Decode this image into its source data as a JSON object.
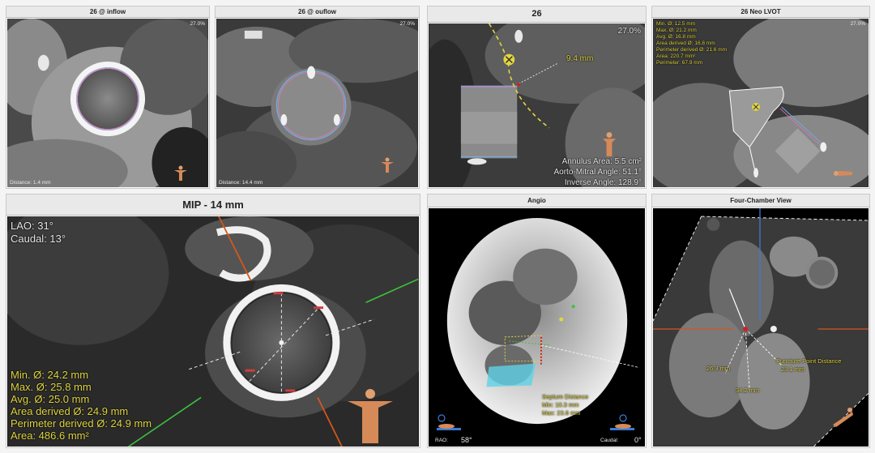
{
  "panels": {
    "inflow": {
      "title": "26 @ inflow",
      "zoom": "27.0%",
      "distance": "Distance: 1.4 mm"
    },
    "outflow": {
      "title": "26 @ ouflow",
      "zoom": "27.0%",
      "distance": "Distance: 14.4 mm"
    },
    "annulus": {
      "title": "26",
      "zoom": "27.0%",
      "dist_label": "9.4 mm",
      "annulus_area": "Annulus Area: 5.5 cm²",
      "aorto_mitral": "Aorto-Mitral Angle: 51.1°",
      "inverse": "Inverse Angle: 128.9°"
    },
    "neo_lvot": {
      "title": "26 Neo LVOT",
      "zoom": "27.0%",
      "measurements": [
        "Min. Ø: 12.5 mm",
        "Max. Ø: 21.2 mm",
        "Avg. Ø: 16.8 mm",
        "Area derived Ø: 16.8 mm",
        "Perimeter derived Ø: 21.6 mm",
        "Area: 220.7 mm²",
        "Perimeter: 67.9 mm"
      ]
    },
    "mip": {
      "title": "MIP - 14 mm",
      "lao": "LAO: 31°",
      "caudal": "Caudal: 13°",
      "measurements": [
        "Min. Ø: 24.2 mm",
        "Max. Ø: 25.8 mm",
        "Avg. Ø: 25.0 mm",
        "Area derived Ø: 24.9 mm",
        "Perimeter derived Ø: 24.9 mm",
        "Area: 486.6 mm²"
      ]
    },
    "angio": {
      "title": "Angio",
      "septum_title": "Septum Distance",
      "septum_min": "Min: 10.3 mm",
      "septum_max": "Max: 23.6 mm",
      "rao_label": "RAO:",
      "rao_value": "58°",
      "caudal_label": "Caudal:",
      "caudal_value": "0°"
    },
    "four_chamber": {
      "title": "Four-Chamber View",
      "d1": "26.3 mm",
      "d2": "34.2 mm",
      "puncture_label": "Puncture Point Distance",
      "puncture_value": "23.1 mm"
    }
  },
  "colors": {
    "measure_yellow": "#e2d640",
    "annulus_pink": "#e07ab0",
    "annulus_blue": "#7aa8e0",
    "orange_line": "#d2581a",
    "green_line": "#3cc23c",
    "cyan_box": "#5fd2e6",
    "blue_axis": "#3a7bd8"
  },
  "icons": [
    "body-orientation-icon",
    "patient-table-icon"
  ]
}
